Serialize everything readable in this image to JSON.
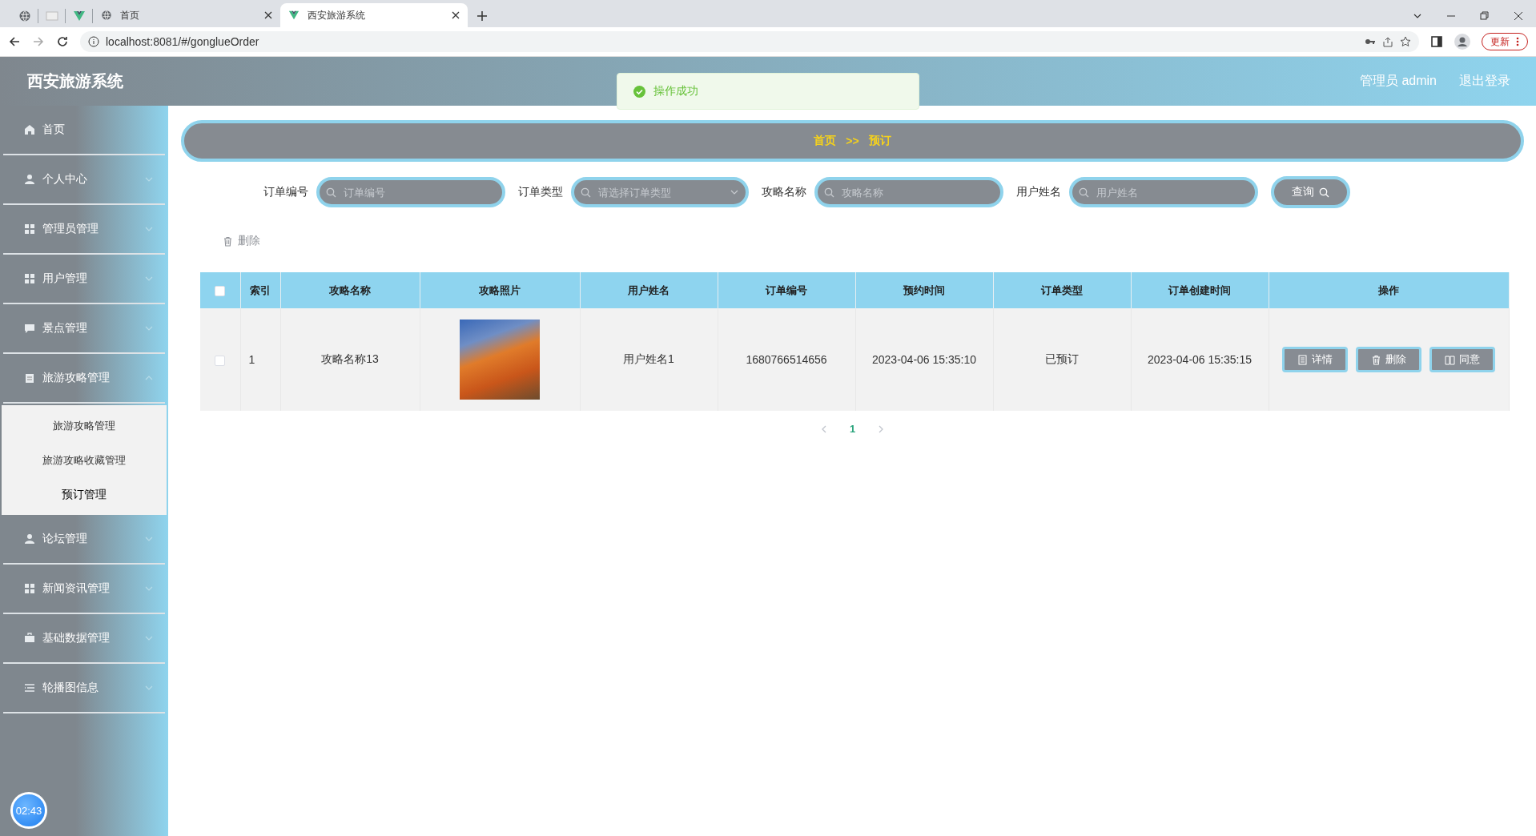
{
  "browser": {
    "tabs": [
      {
        "title": "首页",
        "selected": false
      },
      {
        "title": "西安旅游系统",
        "selected": true
      }
    ],
    "address": "localhost:8081/#/gonglueOrder",
    "update_button": "更新"
  },
  "header": {
    "title": "西安旅游系统",
    "user": "管理员 admin",
    "logout": "退出登录"
  },
  "toast": {
    "message": "操作成功"
  },
  "sidebar": {
    "items": [
      {
        "label": "首页",
        "expandable": false
      },
      {
        "label": "个人中心",
        "expandable": true
      },
      {
        "label": "管理员管理",
        "expandable": true
      },
      {
        "label": "用户管理",
        "expandable": true
      },
      {
        "label": "景点管理",
        "expandable": true
      },
      {
        "label": "旅游攻略管理",
        "expandable": true,
        "expanded": true,
        "children": [
          {
            "label": "旅游攻略管理",
            "selected": false
          },
          {
            "label": "旅游攻略收藏管理",
            "selected": false
          },
          {
            "label": "预订管理",
            "selected": true
          }
        ]
      },
      {
        "label": "论坛管理",
        "expandable": true
      },
      {
        "label": "新闻资讯管理",
        "expandable": true
      },
      {
        "label": "基础数据管理",
        "expandable": true
      },
      {
        "label": "轮播图信息",
        "expandable": true
      }
    ],
    "clock": "02:43"
  },
  "breadcrumb": {
    "items": [
      "首页",
      "预订"
    ],
    "separator": ">>"
  },
  "filters": [
    {
      "label": "订单编号",
      "kind": "text",
      "placeholder": "订单编号"
    },
    {
      "label": "订单类型",
      "kind": "select",
      "placeholder": "请选择订单类型"
    },
    {
      "label": "攻略名称",
      "kind": "text",
      "placeholder": "攻略名称"
    },
    {
      "label": "用户姓名",
      "kind": "text",
      "placeholder": "用户姓名"
    }
  ],
  "search_button": "查询",
  "delete_button": "删除",
  "table": {
    "select_all": {
      "checked": false
    },
    "columns": [
      "索引",
      "攻略名称",
      "攻略照片",
      "用户姓名",
      "订单编号",
      "预约时间",
      "订单类型",
      "订单创建时间",
      "操作"
    ],
    "rows": [
      {
        "checked": false,
        "cells": [
          "1",
          "攻略名称13",
          null,
          "用户姓名1",
          "1680766514656",
          "2023-04-06 15:35:10",
          "已预订",
          "2023-04-06 15:35:15"
        ],
        "actions": [
          "详情",
          "删除",
          "同意"
        ]
      }
    ]
  },
  "pagination": {
    "pages": [
      {
        "label": "1",
        "selected": true
      }
    ]
  }
}
